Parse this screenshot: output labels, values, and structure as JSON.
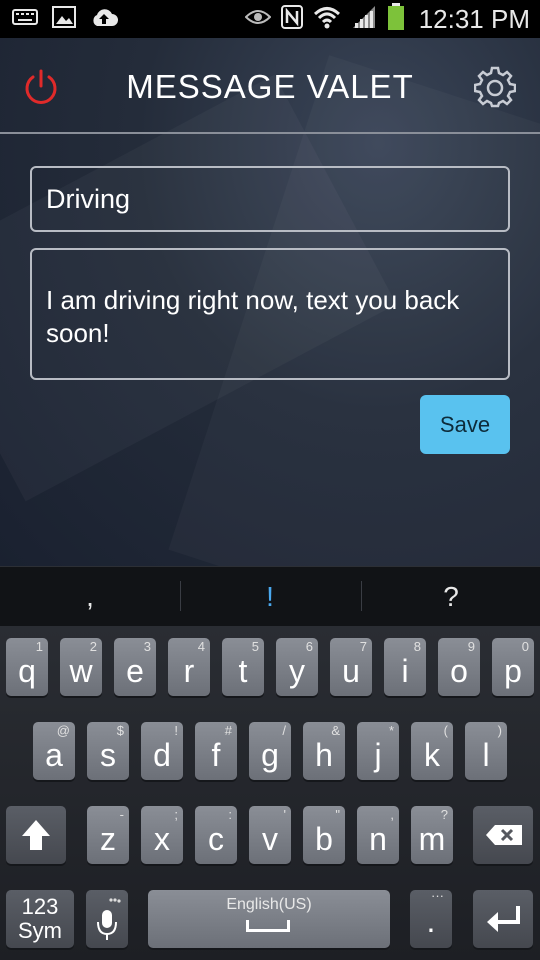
{
  "status_bar": {
    "time": "12:31 PM",
    "icons": [
      "keyboard-icon",
      "image-icon",
      "cloud-upload-icon",
      "eye-icon",
      "nfc-icon",
      "wifi-icon",
      "signal-icon",
      "battery-icon"
    ]
  },
  "app": {
    "title": "MESSAGE VALET",
    "power_color": "#e02a2a",
    "title_field_value": "Driving",
    "message_field_value": "I am driving right now, text you back soon!",
    "save_label": "Save",
    "save_color": "#59c2ef"
  },
  "suggestions": [
    ",",
    "!",
    "?"
  ],
  "keyboard": {
    "row1": [
      {
        "k": "q",
        "s": "1"
      },
      {
        "k": "w",
        "s": "2"
      },
      {
        "k": "e",
        "s": "3"
      },
      {
        "k": "r",
        "s": "4"
      },
      {
        "k": "t",
        "s": "5"
      },
      {
        "k": "y",
        "s": "6"
      },
      {
        "k": "u",
        "s": "7"
      },
      {
        "k": "i",
        "s": "8"
      },
      {
        "k": "o",
        "s": "9"
      },
      {
        "k": "p",
        "s": "0"
      }
    ],
    "row2": [
      {
        "k": "a",
        "s": "@"
      },
      {
        "k": "s",
        "s": "$"
      },
      {
        "k": "d",
        "s": "!"
      },
      {
        "k": "f",
        "s": "#"
      },
      {
        "k": "g",
        "s": "/"
      },
      {
        "k": "h",
        "s": "&"
      },
      {
        "k": "j",
        "s": "*"
      },
      {
        "k": "k",
        "s": "("
      },
      {
        "k": "l",
        "s": ")"
      }
    ],
    "row3": [
      {
        "k": "z",
        "s": "-"
      },
      {
        "k": "x",
        "s": ";"
      },
      {
        "k": "c",
        "s": ":"
      },
      {
        "k": "v",
        "s": "'"
      },
      {
        "k": "b",
        "s": "\""
      },
      {
        "k": "n",
        "s": ","
      },
      {
        "k": "m",
        "s": "?"
      }
    ],
    "sym_label_top": "123",
    "sym_label_bottom": "Sym",
    "space_label": "English(US)",
    "period_label": "."
  }
}
